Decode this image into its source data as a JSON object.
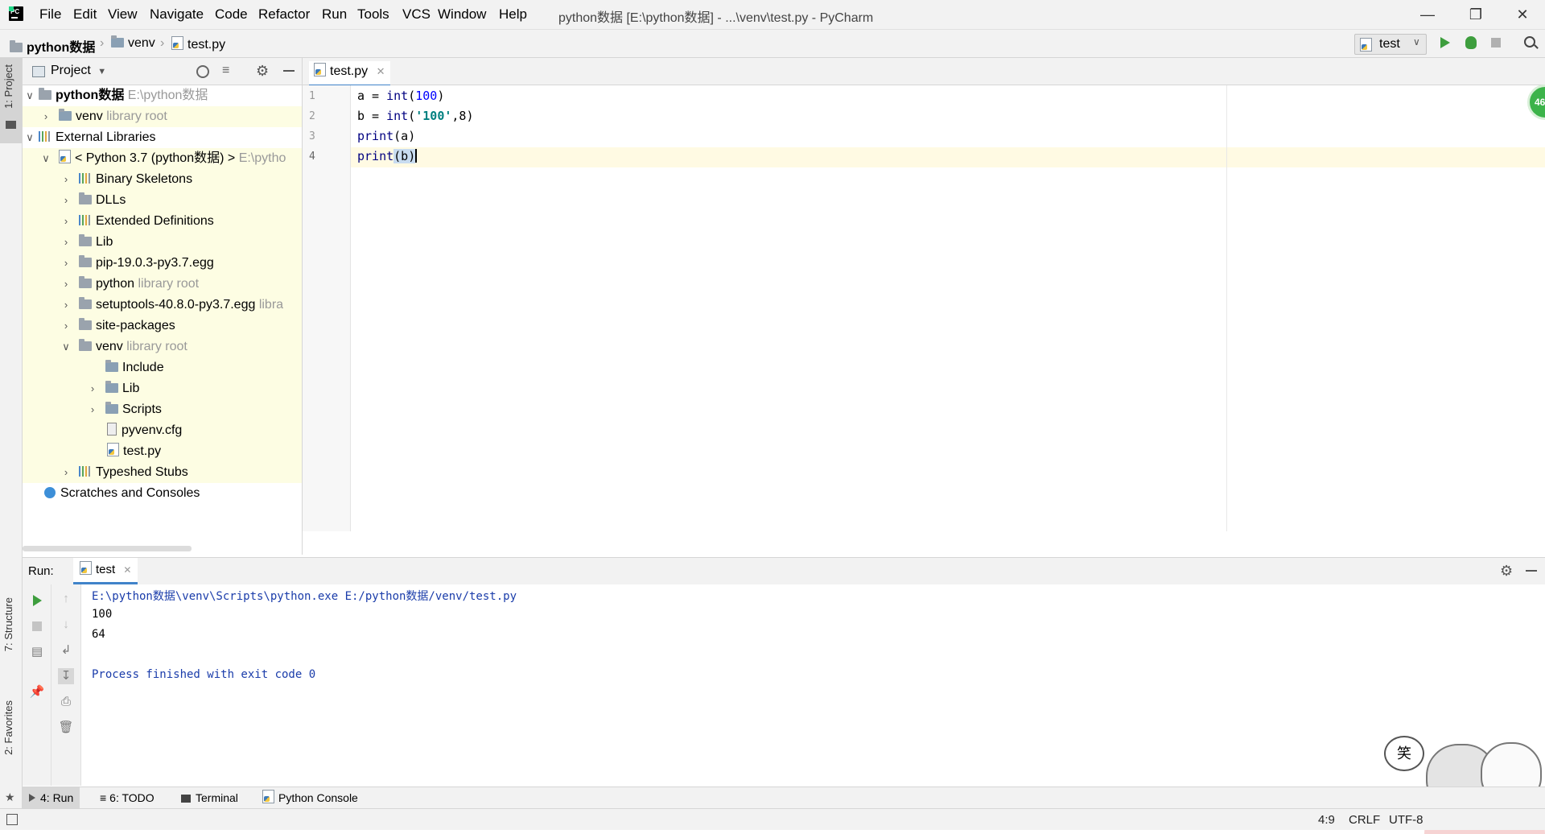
{
  "app": {
    "window_title": "python数据 [E:\\python数据] - ...\\venv\\test.py - PyCharm",
    "menu": [
      "File",
      "Edit",
      "View",
      "Navigate",
      "Code",
      "Refactor",
      "Run",
      "Tools",
      "VCS",
      "Window",
      "Help"
    ]
  },
  "breadcrumb": [
    "python数据",
    "venv",
    "test.py"
  ],
  "run_config": {
    "name": "test"
  },
  "left_strip": {
    "project": "1: Project",
    "structure": "7: Structure",
    "favorites": "2: Favorites"
  },
  "project_panel": {
    "title": "Project",
    "tree": [
      {
        "label": "python数据",
        "hint": "E:\\python数据",
        "bold": true
      },
      {
        "label": "venv",
        "hint": "library root"
      },
      {
        "label": "External Libraries",
        "hint": ""
      },
      {
        "label": "< Python 3.7 (python数据) >",
        "hint": "E:\\pytho"
      },
      {
        "label": "Binary Skeletons",
        "hint": ""
      },
      {
        "label": "DLLs",
        "hint": ""
      },
      {
        "label": "Extended Definitions",
        "hint": ""
      },
      {
        "label": "Lib",
        "hint": ""
      },
      {
        "label": "pip-19.0.3-py3.7.egg",
        "hint": ""
      },
      {
        "label": "python",
        "hint": "library root"
      },
      {
        "label": "setuptools-40.8.0-py3.7.egg",
        "hint": "libra"
      },
      {
        "label": "site-packages",
        "hint": ""
      },
      {
        "label": "venv",
        "hint": "library root"
      },
      {
        "label": "Include",
        "hint": ""
      },
      {
        "label": "Lib",
        "hint": ""
      },
      {
        "label": "Scripts",
        "hint": ""
      },
      {
        "label": "pyvenv.cfg",
        "hint": ""
      },
      {
        "label": "test.py",
        "hint": ""
      },
      {
        "label": "Typeshed Stubs",
        "hint": ""
      },
      {
        "label": "Scratches and Consoles",
        "hint": ""
      }
    ]
  },
  "editor": {
    "tab": "test.py",
    "line_numbers": [
      "1",
      "2",
      "3",
      "4"
    ],
    "lines": [
      {
        "a": "a = ",
        "b": "int",
        "c": "(",
        "d": "100",
        "e": ")"
      },
      {
        "a": "b = ",
        "b": "int",
        "c": "(",
        "d": "'100'",
        "e": ",8)"
      },
      {
        "a": "print",
        "b": "(a)"
      },
      {
        "a": "print",
        "b": "(b)"
      }
    ],
    "badge": "46"
  },
  "run_panel": {
    "label": "Run:",
    "tab": "test",
    "output": [
      "E:\\python数据\\venv\\Scripts\\python.exe E:/python数据/venv/test.py",
      "100",
      "64",
      "",
      "Process finished with exit code 0"
    ]
  },
  "bottom_tabs": [
    "4: Run",
    "6: TODO",
    "Terminal",
    "Python Console"
  ],
  "status": {
    "position": "4:9",
    "line_sep": "CRLF",
    "encoding": "UTF-8"
  },
  "sticker_text": "笑"
}
